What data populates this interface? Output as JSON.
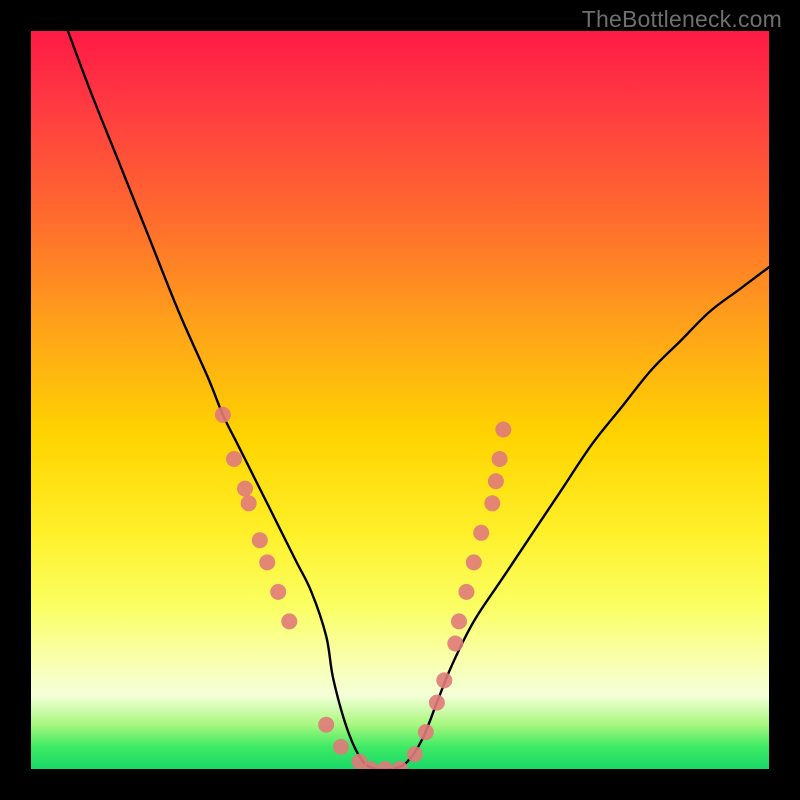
{
  "watermark": "TheBottleneck.com",
  "chart_data": {
    "type": "line",
    "title": "",
    "xlabel": "",
    "ylabel": "",
    "xlim": [
      0,
      100
    ],
    "ylim": [
      0,
      100
    ],
    "series": [
      {
        "name": "bottleneck-curve",
        "x": [
          5,
          8,
          12,
          16,
          20,
          24,
          26,
          28,
          30,
          32,
          34,
          36,
          38,
          40,
          41,
          43,
          45,
          47,
          49,
          51,
          53,
          55,
          57,
          60,
          64,
          68,
          72,
          76,
          80,
          84,
          88,
          92,
          96,
          100
        ],
        "values": [
          100,
          92,
          82,
          72,
          62,
          53,
          48,
          44,
          40,
          36,
          32,
          28,
          24,
          18,
          12,
          5,
          1,
          0,
          0,
          1,
          4,
          9,
          14,
          20,
          26,
          32,
          38,
          44,
          49,
          54,
          58,
          62,
          65,
          68
        ]
      }
    ],
    "markers": {
      "name": "sample-points",
      "color": "#e07a7a",
      "radius_px": 8,
      "points": [
        {
          "x": 26.0,
          "y": 48
        },
        {
          "x": 27.5,
          "y": 42
        },
        {
          "x": 29.0,
          "y": 38
        },
        {
          "x": 29.5,
          "y": 36
        },
        {
          "x": 31.0,
          "y": 31
        },
        {
          "x": 32.0,
          "y": 28
        },
        {
          "x": 33.5,
          "y": 24
        },
        {
          "x": 35.0,
          "y": 20
        },
        {
          "x": 40.0,
          "y": 6
        },
        {
          "x": 42.0,
          "y": 3
        },
        {
          "x": 44.5,
          "y": 1
        },
        {
          "x": 46.0,
          "y": 0
        },
        {
          "x": 48.0,
          "y": 0
        },
        {
          "x": 50.0,
          "y": 0
        },
        {
          "x": 52.0,
          "y": 2
        },
        {
          "x": 53.5,
          "y": 5
        },
        {
          "x": 55.0,
          "y": 9
        },
        {
          "x": 56.0,
          "y": 12
        },
        {
          "x": 57.5,
          "y": 17
        },
        {
          "x": 58.0,
          "y": 20
        },
        {
          "x": 59.0,
          "y": 24
        },
        {
          "x": 60.0,
          "y": 28
        },
        {
          "x": 61.0,
          "y": 32
        },
        {
          "x": 62.5,
          "y": 36
        },
        {
          "x": 63.0,
          "y": 39
        },
        {
          "x": 63.5,
          "y": 42
        },
        {
          "x": 64.0,
          "y": 46
        }
      ]
    }
  }
}
